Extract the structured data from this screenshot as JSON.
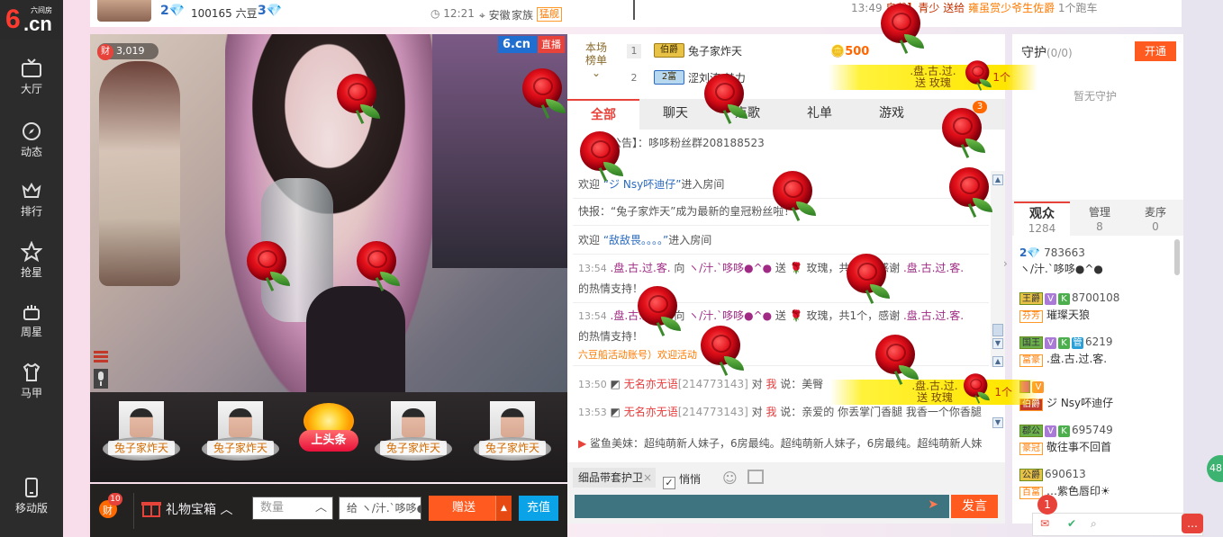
{
  "logo": {
    "mark": "6",
    "domain": ".cn",
    "sub": "六间房"
  },
  "nav": {
    "items": [
      {
        "label": "大厅",
        "icon": "tv-icon"
      },
      {
        "label": "动态",
        "icon": "compass-icon"
      },
      {
        "label": "排行",
        "icon": "crown-icon"
      },
      {
        "label": "抢星",
        "icon": "star-icon"
      },
      {
        "label": "周星",
        "icon": "cake-icon"
      },
      {
        "label": "马甲",
        "icon": "shirt-icon"
      }
    ],
    "mobile": "移动版"
  },
  "topbar": {
    "level_num": "2",
    "id_beans": "100165 六豆",
    "level_num2": "3",
    "time": "12:21",
    "region": "安徽",
    "family_label": "家族",
    "family_badge": "猛舰",
    "ticker_time": "13:49",
    "ticker_text1": "皇戴】青少 送给",
    "ticker_text2": "雍虽赏少爷生佐爵",
    "ticker_text3": "1个跑车"
  },
  "video": {
    "wealth_label": "财",
    "wealth_value": "3,019",
    "live_brand": "6.cn",
    "live_label": "直播"
  },
  "headline": {
    "items": [
      "兔子家炸天",
      "兔子家炸天",
      "兔子家炸天",
      "兔子家炸天"
    ],
    "center_label": "上头条"
  },
  "giftbar": {
    "cai_badge": "10",
    "cai_label": "财",
    "giftbox_label": "礼物宝箱",
    "qty_placeholder": "数量",
    "to_text": "给 ヽ/汁.`哆哆●^●",
    "send_label": "赠送",
    "recharge_label": "充值"
  },
  "ranking": {
    "header": "本场\n榜单",
    "rows": [
      {
        "num": "1",
        "badge": "伯爵",
        "name": "兔子家炸天"
      },
      {
        "num": "2",
        "badge": "2富",
        "name": "涩刘涛 魅力"
      }
    ],
    "coins": "500"
  },
  "chat": {
    "tabs": [
      "全部",
      "聊天",
      "点歌",
      "礼单",
      "游戏"
    ],
    "tab_badge": "3",
    "messages": [
      {
        "a": "【房间公告】：",
        "b": "哆哆粉丝群208188523"
      },
      {
        "a": "欢迎 ",
        "b": "“ジ Nsy吥迪仔”",
        "c": "进入房间"
      },
      {
        "a": "快报：“兔子家炸天”成为最新的皇冠粉丝啦！"
      },
      {
        "a": "欢迎 ",
        "b": "“敌敌畏。。。。”",
        "c": "进入房间"
      },
      {
        "t": "13:54",
        "a": ".盘.古.过.客.",
        "b": " 向 ",
        "c": "ヽ/汁.`哆哆●^●",
        "d": " 送 🌹 玫瑰，共1个，感谢 ",
        "e": ".盘.古.过.客.",
        "f": " 的热情支持！"
      },
      {
        "t": "13:54",
        "a": ".盘.古.过.客.",
        "b": " 向 ",
        "c": "ヽ/汁.`哆哆●^●",
        "d": " 送 🌹 玫瑰，共1个，感谢 ",
        "e": ".盘.古.过.客.",
        "f": " 的热情支持！"
      },
      {
        "a": "六豆船活动账号）欢迎活动"
      },
      {
        "t": "13:50",
        "a": "无名亦无语",
        "b": "[214773143]",
        "c": " 对 ",
        "d": "我",
        "e": " 说：美臀"
      },
      {
        "t": "13:53",
        "a": "无名亦无语",
        "b": "[214773143]",
        "c": " 对 ",
        "d": "我",
        "e": " 说：亲爱的 你丢掌门香腿 我香一个你香腿"
      }
    ],
    "announce": "鲨鱼美妹：超纯萌新人妹子，6房最纯。超纯萌新人妹子，6房最纯。超纯萌新人妹",
    "guard_gift": "细品带套护卫",
    "quiet_label": "悄悄",
    "send_label": "发言"
  },
  "banners": [
    {
      "l1": ".盘.古.过.",
      "l2": "送 玫瑰",
      "count": "1个"
    },
    {
      "l1": ".盘.古.过.",
      "l2": "送 玫瑰",
      "count": "1个"
    }
  ],
  "guard": {
    "title": "守护",
    "count": "(0/0)",
    "open_label": "开通",
    "empty": "暂无守护"
  },
  "viewers": {
    "tabs": [
      {
        "label": "观众",
        "count": "1284"
      },
      {
        "label": "管理",
        "count": "8"
      },
      {
        "label": "麦序",
        "count": "0"
      }
    ],
    "rows": [
      {
        "lvl": "2💎",
        "id": "783663",
        "name": "ヽ/汁.`哆哆●^●"
      },
      {
        "lvl": "王爵",
        "id": "8700108",
        "fan": "芬芳",
        "name": "璀璨天狼"
      },
      {
        "lvl": "国王",
        "id": "6219",
        "fan": "富豪",
        "name": ".盘.古.过.客."
      },
      {
        "lvl": "",
        "id": "",
        "fan": "伯爵",
        "name": "ジ Nsy吥迪仔"
      },
      {
        "lvl": "郡公",
        "id": "695749",
        "fan": "豪冠",
        "name": "敬往事不回首"
      },
      {
        "lvl": "公爵",
        "id": "690613",
        "fan": "百富",
        "name": "…紫色唇印☀"
      }
    ]
  },
  "notify": {
    "count": "1"
  },
  "side": {
    "label": "48"
  },
  "colors": {
    "accent": "#e8433b",
    "send": "#ff5a1f",
    "recharge": "#0ba3e8",
    "nav_bg": "#2c2c2c"
  }
}
